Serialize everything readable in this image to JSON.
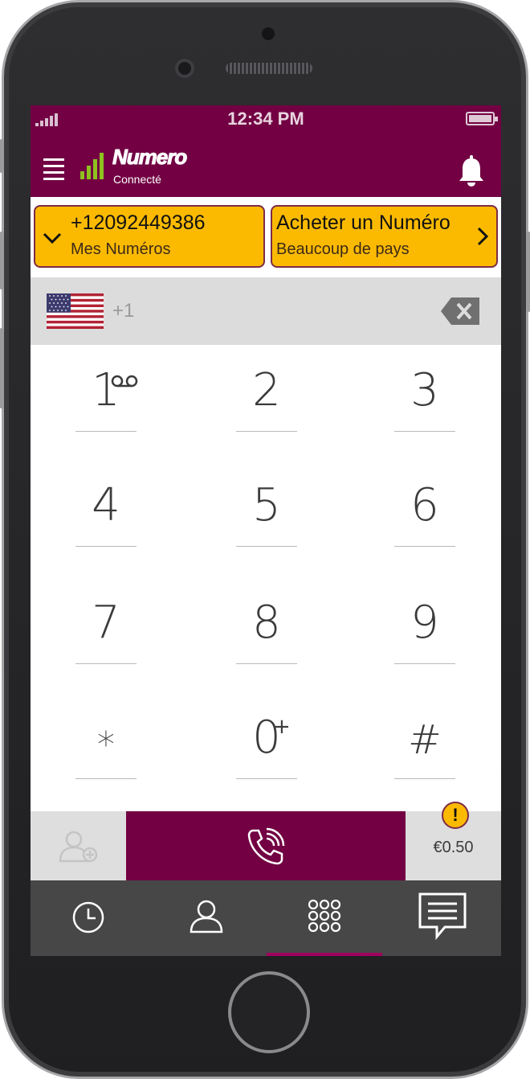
{
  "status_bar": {
    "time": "12:34 PM"
  },
  "app_bar": {
    "logo": "Numero",
    "connection_status": "Connecté"
  },
  "cards": {
    "my_numbers": {
      "number": "+12092449386",
      "label": "Mes Numéros"
    },
    "buy_number": {
      "title": "Acheter un Numéro",
      "subtitle": "Beaucoup de pays"
    }
  },
  "dial_entry": {
    "country_prefix": "+1",
    "country_flag": "us-flag-icon"
  },
  "keypad": {
    "keys": [
      {
        "digit": "1",
        "sup": "voicemail-icon"
      },
      {
        "digit": "2"
      },
      {
        "digit": "3"
      },
      {
        "digit": "4"
      },
      {
        "digit": "5"
      },
      {
        "digit": "6"
      },
      {
        "digit": "7"
      },
      {
        "digit": "8"
      },
      {
        "digit": "9"
      },
      {
        "digit": "*"
      },
      {
        "digit": "0",
        "sup": "+"
      },
      {
        "digit": "#"
      }
    ]
  },
  "actions": {
    "credit": "€0.50",
    "warning": "!"
  },
  "tabs": [
    {
      "icon": "recent-calls-icon",
      "active": false
    },
    {
      "icon": "contacts-icon",
      "active": false
    },
    {
      "icon": "keypad-icon",
      "active": true
    },
    {
      "icon": "messages-icon",
      "active": false
    }
  ],
  "colors": {
    "brand": "#720043",
    "accent": "#fbba00",
    "tab_bar": "#474747"
  }
}
